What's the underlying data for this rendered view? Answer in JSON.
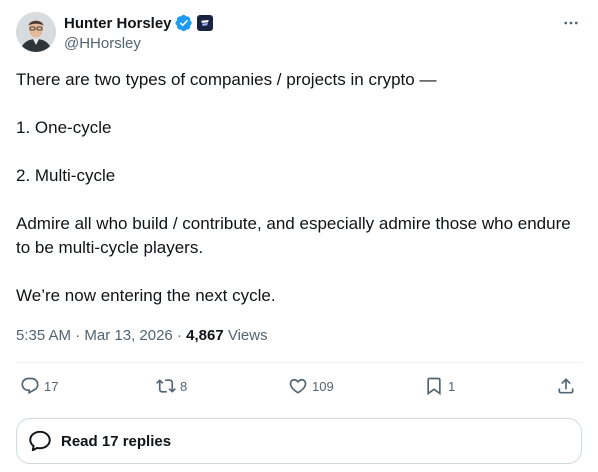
{
  "author": {
    "display_name": "Hunter Horsley",
    "handle": "@HHorsley",
    "verified_icon": "verified-badge-icon",
    "affiliate_icon": "affiliate-logo-icon",
    "colors": {
      "verified": "#1d9bf0",
      "affiliate_bg": "#1a2440"
    }
  },
  "tweet": {
    "paragraphs": [
      "There are two types of companies / projects in crypto —",
      "1. One-cycle",
      "2. Multi-cycle",
      "Admire all who build / contribute, and especially admire those who endure to be multi-cycle players.",
      "We’re now entering the next cycle."
    ]
  },
  "meta": {
    "time": "5:35 AM",
    "sep1": " · ",
    "date": "Mar 13, 2026",
    "sep2": " · ",
    "views_count": "4,867",
    "views_label": " Views"
  },
  "actions": {
    "reply": {
      "icon": "reply-icon",
      "count": "17"
    },
    "repost": {
      "icon": "repost-icon",
      "count": "8"
    },
    "like": {
      "icon": "like-icon",
      "count": "109"
    },
    "bookmark": {
      "icon": "bookmark-icon",
      "count": "1"
    },
    "share": {
      "icon": "share-icon"
    }
  },
  "replies_button": {
    "icon": "speech-bubble-icon",
    "label": "Read 17 replies"
  },
  "more_icon": "more-options-icon"
}
